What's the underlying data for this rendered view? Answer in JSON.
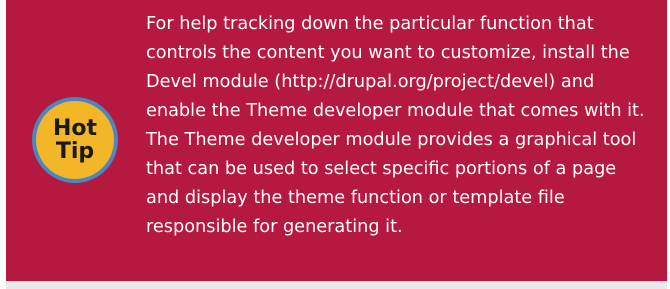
{
  "badge": {
    "line1": "Hot",
    "line2": "Tip"
  },
  "tip": {
    "text": "For help tracking down the particular function that controls the content you want to customize, install the Devel module (http://drupal.org/project/devel) and enable the Theme developer module that comes with it. The Theme developer module provides a graphical tool that can be used to select specific portions of a page and display the theme function or template file responsible for generating it."
  },
  "colors": {
    "background": "#b5193f",
    "badge_fill": "#f3b629",
    "badge_ring": "#4b86c1",
    "text": "#ffffff"
  }
}
